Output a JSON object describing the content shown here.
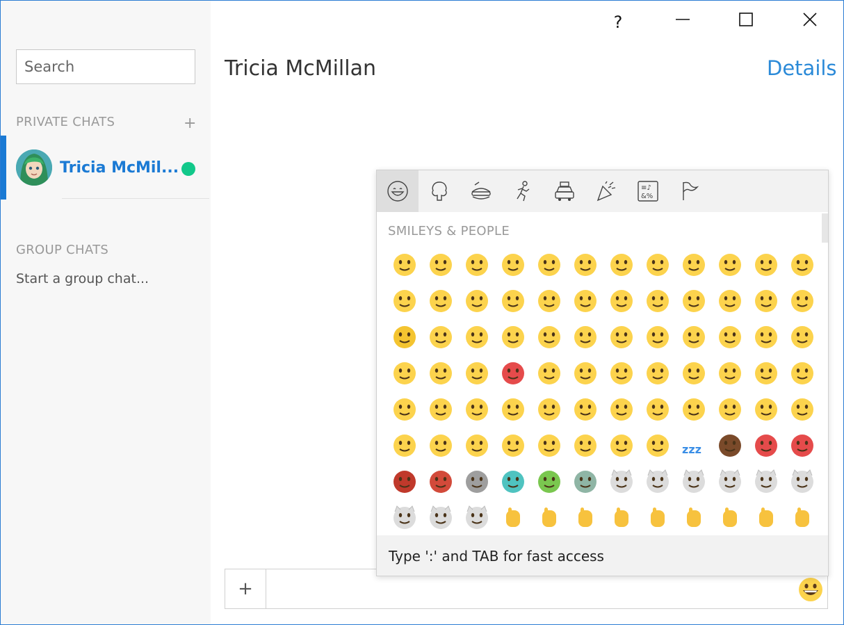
{
  "window": {
    "help_label": "?"
  },
  "sidebar": {
    "search_placeholder": "Search",
    "private_chats_label": "PRIVATE CHATS",
    "add_chat_label": "+",
    "chats": [
      {
        "name": "Tricia McMil...",
        "status": "online",
        "status_color": "#12c88a"
      }
    ],
    "group_chats_label": "GROUP CHATS",
    "start_group_label": "Start a group chat..."
  },
  "conversation": {
    "title": "Tricia McMillan",
    "details_label": "Details"
  },
  "composer": {
    "attach_label": "+",
    "message_value": "",
    "emoji_button_icon": "grinning-face-icon"
  },
  "emoji_panel": {
    "tabs": [
      {
        "icon": "smiley-category-icon",
        "active": true
      },
      {
        "icon": "tree-category-icon",
        "active": false
      },
      {
        "icon": "food-category-icon",
        "active": false
      },
      {
        "icon": "runner-category-icon",
        "active": false
      },
      {
        "icon": "car-category-icon",
        "active": false
      },
      {
        "icon": "party-category-icon",
        "active": false
      },
      {
        "icon": "symbols-category-icon",
        "active": false
      },
      {
        "icon": "flag-category-icon",
        "active": false
      }
    ],
    "section_label": "SMILEYS & PEOPLE",
    "emojis": [
      "grinning",
      "grimacing",
      "grin",
      "joy",
      "smiley",
      "smile",
      "sweat-smile",
      "laughing",
      "innocent",
      "wink",
      "blush",
      "slight-smile",
      "upside-down",
      "slight-smile-2",
      "yum",
      "relieved",
      "heart-eyes",
      "kissing-heart",
      "kissing",
      "kissing-smiling",
      "kissing-closed-eyes",
      "stuck-out-tongue-wink",
      "stuck-out-tongue-closed",
      "stuck-out-tongue",
      "money-mouth",
      "nerd",
      "sunglasses",
      "hugging",
      "smirk",
      "no-mouth",
      "neutral",
      "expressionless",
      "unamused",
      "rolling-eyes",
      "thinking",
      "flushed",
      "disappointed",
      "worried",
      "angry",
      "rage",
      "pensive",
      "confused",
      "slight-frown",
      "frowning",
      "persevere",
      "confounded",
      "tired",
      "weary",
      "triumph",
      "open-mouth",
      "scream",
      "fearful",
      "cold-sweat",
      "hushed",
      "frowning-open",
      "anguished",
      "cry",
      "disappointed-relieved",
      "sleepy",
      "sweat",
      "sob",
      "dizzy",
      "astonished",
      "zipper-mouth",
      "mask",
      "thermometer",
      "bandage",
      "sleeping",
      "zzz",
      "poop",
      "smiling-imp",
      "imp",
      "japanese-ogre",
      "japanese-goblin",
      "skull",
      "ghost",
      "alien",
      "robot",
      "smiley-cat",
      "smile-cat",
      "joy-cat",
      "heart-eyes-cat",
      "smirk-cat",
      "kissing-cat",
      "scream-cat",
      "crying-cat",
      "pouting-cat",
      "raised-hands",
      "clap",
      "wave",
      "thumbsup",
      "thumbsdown",
      "punch",
      "fist",
      "v",
      "ok-hand"
    ],
    "footer_text": "Type ':' and TAB for fast access"
  },
  "colors": {
    "accent": "#1b7ad4",
    "link": "#2b8ad8",
    "online": "#12c88a",
    "emoji_yellow": "#fcd34d"
  }
}
